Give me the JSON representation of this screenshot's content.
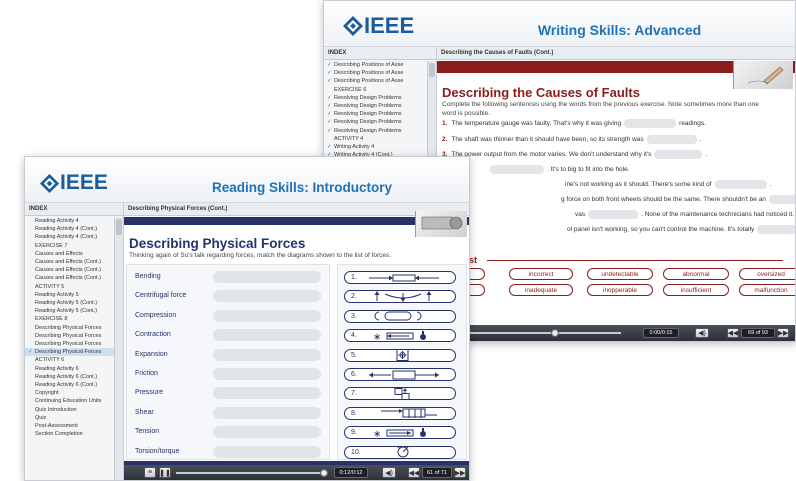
{
  "brand": "IEEE",
  "back_window": {
    "title": "Writing Skills: Advanced",
    "index_header": "INDEX",
    "breadcrumb": "Describing the Causes of Faults (Cont.)",
    "index_items": [
      {
        "label": "Describing Positions of Asse",
        "done": true
      },
      {
        "label": "Describing Positions of Asse",
        "done": true
      },
      {
        "label": "Describing Positions of Asse",
        "done": true
      },
      {
        "label": "EXERCISE 6",
        "done": false
      },
      {
        "label": "Resolving Design Problems",
        "done": true
      },
      {
        "label": "Resolving Design Problems",
        "done": true
      },
      {
        "label": "Resolving Design Problems",
        "done": true
      },
      {
        "label": "Resolving Design Problems",
        "done": true
      },
      {
        "label": "Resolving Design Problems",
        "done": true
      },
      {
        "label": "ACTIVITY 4",
        "done": false
      },
      {
        "label": "Writing Activity 4",
        "done": true
      },
      {
        "label": "Writing Activity 4 (Cont.)",
        "done": true
      }
    ],
    "heading": "Describing the Causes of Faults",
    "intro": "Complete the following sentences using the words from the previous exercise. Note sometimes more than one word is possible.",
    "sentences": [
      {
        "num": "1.",
        "before": "The temperature gauge was faulty. That's why it was giving",
        "after": "readings."
      },
      {
        "num": "2.",
        "before": "The shaft was thinner than it should have been, so its  strength was",
        "after": "."
      },
      {
        "num": "3.",
        "before": "The power output from the motor varies. We don't understand why it's",
        "after": "."
      },
      {
        "num": "",
        "before": "",
        "after": ". It's to big to fit into the hole."
      },
      {
        "num": "",
        "before": "ine's not working as it should. There's some kind of",
        "after": "."
      },
      {
        "num": "",
        "before": "g force on both front wheels should be the same. There shouldn't be an",
        "after": "."
      },
      {
        "num": "",
        "before": "vas",
        "after": ". None of the maintenance technicians had noticed it."
      },
      {
        "num": "",
        "before": "ol panel isn't working, so you can't control the machine. It's totally",
        "after": "."
      }
    ],
    "word_list_title": "List",
    "words_row1": [
      "ance",
      "incorrect",
      "undetectable",
      "abnormal",
      "oversized"
    ],
    "words_row2": [
      "ular",
      "inadequate",
      "inopperable",
      "insufficient",
      "malfunction"
    ],
    "player": {
      "time": "0:00/0:15",
      "page": "69 of 93"
    }
  },
  "front_window": {
    "title": "Reading Skills: Introductory",
    "index_header": "INDEX",
    "breadcrumb": "Describing Physical Forces (Cont.)",
    "index_items": [
      {
        "label": "Reading Activity 4",
        "done": false,
        "active": false
      },
      {
        "label": "Reading Activity 4 (Cont.)",
        "done": false,
        "active": false
      },
      {
        "label": "Reading Activity 4 (Cont.)",
        "done": false,
        "active": false
      },
      {
        "label": "EXERCISE 7",
        "done": false,
        "active": false
      },
      {
        "label": "Causes and Effects",
        "done": false,
        "active": false
      },
      {
        "label": "Causes and Effects (Cont.)",
        "done": false,
        "active": false
      },
      {
        "label": "Causes and Effects (Cont.)",
        "done": false,
        "active": false
      },
      {
        "label": "Causes and Effects (Cont.)",
        "done": false,
        "active": false
      },
      {
        "label": "ACTIVITY 5",
        "done": false,
        "active": false
      },
      {
        "label": "Reading Activity 5",
        "done": false,
        "active": false
      },
      {
        "label": "Reading Activity 5 (Cont.)",
        "done": false,
        "active": false
      },
      {
        "label": "Reading Activity 5 (Cont.)",
        "done": false,
        "active": false
      },
      {
        "label": "EXERCISE 8",
        "done": false,
        "active": false
      },
      {
        "label": "Describing Physical Forces",
        "done": false,
        "active": false
      },
      {
        "label": "Describing Physical Forces",
        "done": false,
        "active": false
      },
      {
        "label": "Describing Physical Forces",
        "done": false,
        "active": false
      },
      {
        "label": "Describing Physical Forces",
        "done": true,
        "active": true
      },
      {
        "label": "ACTIVITY 6",
        "done": false,
        "active": false
      },
      {
        "label": "Reading Activity 6",
        "done": false,
        "active": false
      },
      {
        "label": "Reading Activity 6 (Cont.)",
        "done": false,
        "active": false
      },
      {
        "label": "Reading Activity 6 (Cont.)",
        "done": false,
        "active": false
      },
      {
        "label": "Copyright",
        "done": false,
        "active": false
      },
      {
        "label": "Continuing Education Units",
        "done": false,
        "active": false
      },
      {
        "label": "Quiz Introduction",
        "done": false,
        "active": false
      },
      {
        "label": "Quiz",
        "done": false,
        "active": false
      },
      {
        "label": "Post-Assessment",
        "done": false,
        "active": false
      },
      {
        "label": "Section Completion",
        "done": false,
        "active": false
      }
    ],
    "heading": "Describing Physical Forces",
    "instruction": "Thinking again of Su's talk regarding forces, match the diagrams shown to the list of forces.",
    "terms": [
      "Bending",
      "Centrifugal force",
      "Compression",
      "Contraction",
      "Expansion",
      "Friction",
      "Pressure",
      "Shear",
      "Tension",
      "Torsion/torque"
    ],
    "diagram_numbers": [
      "1.",
      "2.",
      "3.",
      "4.",
      "5.",
      "6.",
      "7.",
      "8.",
      "9.",
      "10."
    ],
    "player": {
      "time": "0:12/0:12",
      "page": "61 of 71"
    }
  },
  "colors": {
    "writing_accent": "#8b1d1d",
    "reading_accent": "#27326b",
    "title_blue": "#1f72b8"
  }
}
